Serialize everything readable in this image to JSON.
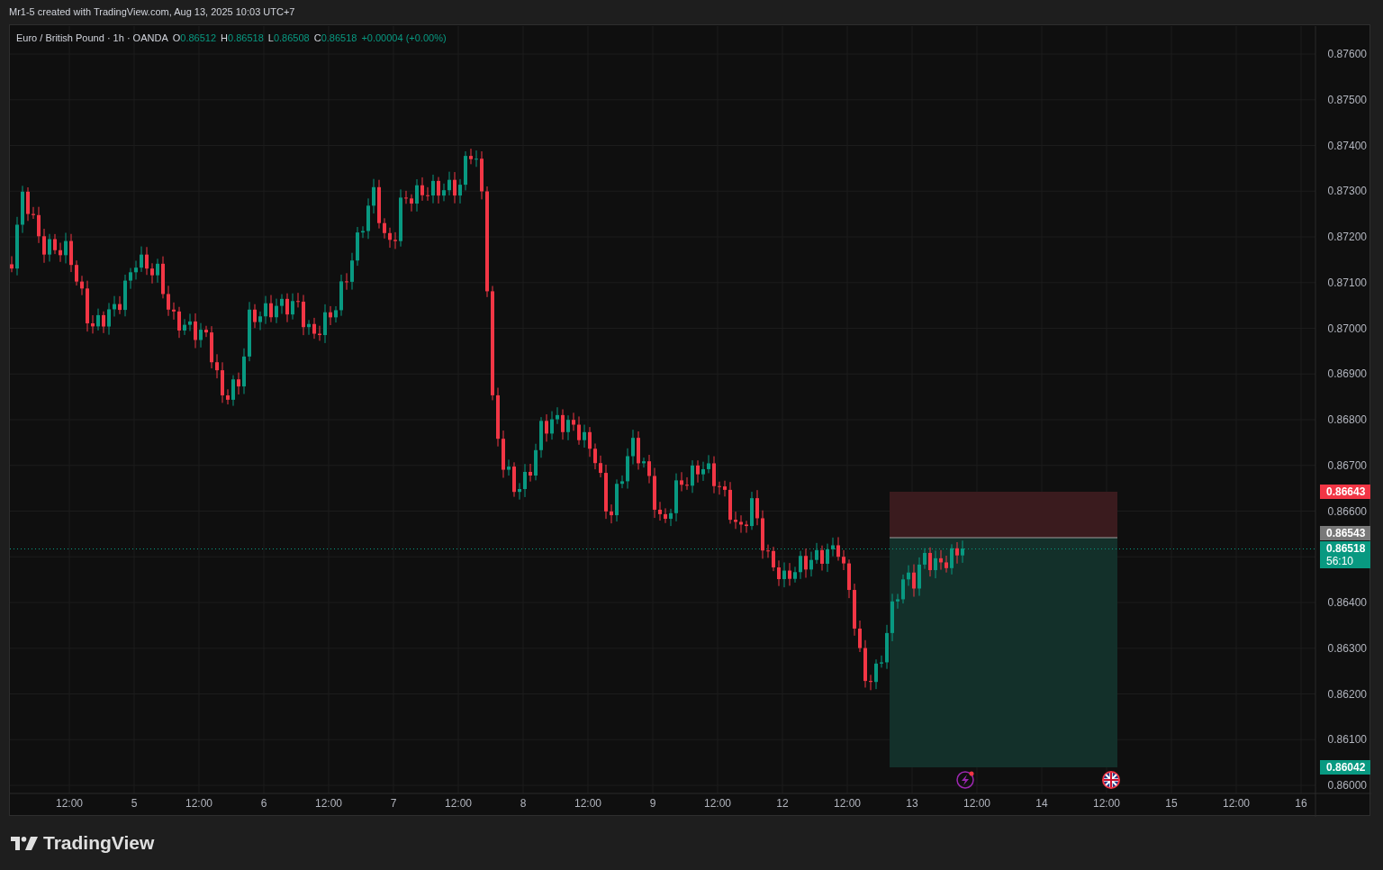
{
  "caption": "Mr1-5 created with TradingView.com, Aug 13, 2025 10:03 UTC+7",
  "legend": {
    "symbol": "Euro / British Pound · 1h · OANDA",
    "ohlc": [
      {
        "label": "O",
        "value": "0.86512"
      },
      {
        "label": "H",
        "value": "0.86518"
      },
      {
        "label": "L",
        "value": "0.86508"
      },
      {
        "label": "C",
        "value": "0.86518"
      }
    ],
    "change": "+0.00004 (+0.00%)"
  },
  "price_axis": [
    "0.87600",
    "0.87500",
    "0.87400",
    "0.87300",
    "0.87200",
    "0.87100",
    "0.87000",
    "0.86900",
    "0.86800",
    "0.86700",
    "0.86600",
    "0.86400",
    "0.86300",
    "0.86200",
    "0.86100",
    "0.86000"
  ],
  "price_tags": [
    {
      "kind": "stop",
      "text": "0.86643",
      "color": "#f23645"
    },
    {
      "kind": "entry",
      "text": "0.86543",
      "color": "#787878"
    },
    {
      "kind": "current",
      "text": "0.86518",
      "countdown": "56:10",
      "color": "#089981"
    },
    {
      "kind": "target",
      "text": "0.86042",
      "color": "#089981"
    }
  ],
  "time_axis": [
    "12:00",
    "5",
    "12:00",
    "6",
    "12:00",
    "7",
    "12:00",
    "8",
    "12:00",
    "9",
    "12:00",
    "12",
    "12:00",
    "13",
    "12:00",
    "14",
    "12:00",
    "15",
    "12:00",
    "16"
  ],
  "logo": "TradingView"
}
